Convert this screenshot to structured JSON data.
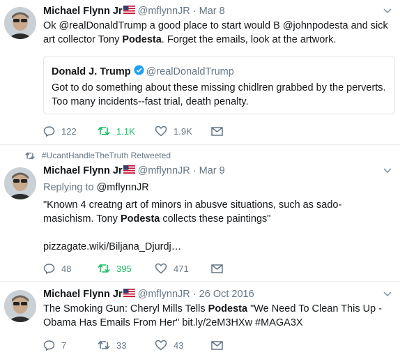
{
  "colors": {
    "text": "#14171a",
    "muted": "#657786",
    "retweet_active": "#17bf63",
    "verified": "#1da1f2",
    "divider": "#e6ecf0"
  },
  "tweets": [
    {
      "author_name": "Michael Flynn Jr",
      "flag_icon": "us-flag-icon",
      "handle_time": "@mflynnJR · Mar 8",
      "text_parts": {
        "p1": "Ok @realDonaldTrump a good place to start would B @johnpodesta and sick art collector Tony ",
        "bold": "Podesta",
        "p2": ". Forget the emails, look at the artwork."
      },
      "quoted": {
        "name": "Donald J. Trump",
        "verified_icon": "verified-badge-icon",
        "handle": "@realDonaldTrump",
        "text": "Got to do something about these missing chidlren grabbed by the perverts. Too many incidents--fast trial, death penalty."
      },
      "actions": {
        "replies": "122",
        "retweets": "1.1K",
        "likes": "1.9K"
      }
    },
    {
      "context": "#UcantHandleTheTruth Retweeted",
      "author_name": "Michael Flynn Jr",
      "flag_icon": "us-flag-icon",
      "handle_time": "@mflynnJR · Mar 9",
      "replying_label": "Replying to ",
      "replying_to": "@mflynnJR",
      "text_parts": {
        "p1": "\"Known 4 creatng art of minors in abusve situations, such as sado-masichism. Tony ",
        "bold": "Podesta",
        "p2": " collects these paintings\""
      },
      "link": "pizzagate.wiki/Biljana_Djurdj…",
      "actions": {
        "replies": "48",
        "retweets": "395",
        "likes": "471"
      }
    },
    {
      "author_name": "Michael Flynn Jr",
      "flag_icon": "us-flag-icon",
      "handle_time": "@mflynnJR · 26 Oct 2016",
      "text_parts": {
        "p1": "The Smoking Gun: Cheryl Mills Tells ",
        "bold": "Podesta",
        "p2": " \"We Need To Clean This Up - Obama Has Emails From Her\" bit.ly/2eM3HXw #MAGA3X"
      },
      "actions": {
        "replies": "7",
        "retweets": "33",
        "likes": "43"
      }
    }
  ]
}
